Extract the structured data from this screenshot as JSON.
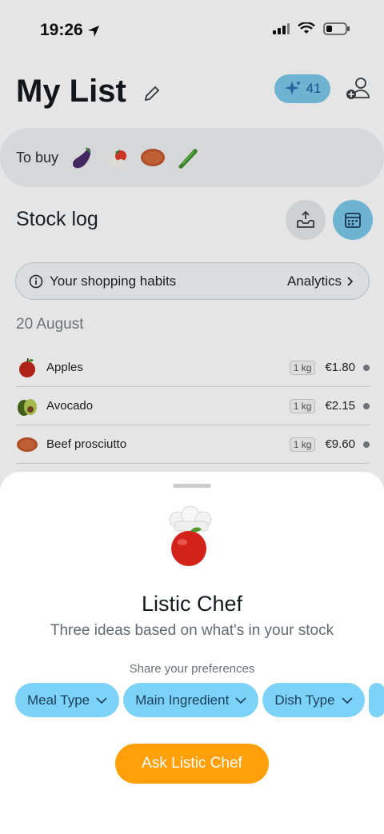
{
  "status_bar": {
    "time": "19:26"
  },
  "header": {
    "title": "My List",
    "ai_credits": "41"
  },
  "to_buy": {
    "label": "To buy",
    "items": [
      "eggplant-icon",
      "caprese-icon",
      "beef-prosciutto-icon",
      "cucumber-icon"
    ]
  },
  "stock_log": {
    "title": "Stock log",
    "habits_label": "Your shopping habits",
    "analytics_label": "Analytics",
    "date": "20 August",
    "rows": [
      {
        "name": "Apples",
        "qty": "1 kg",
        "price": "€1.80",
        "icon": "apple-icon"
      },
      {
        "name": "Avocado",
        "qty": "1 kg",
        "price": "€2.15",
        "icon": "avocado-icon"
      },
      {
        "name": "Beef prosciutto",
        "qty": "1 kg",
        "price": "€9.60",
        "icon": "beef-prosciutto-icon"
      }
    ]
  },
  "sheet": {
    "title": "Listic Chef",
    "subtitle": "Three ideas based on what's in your stock",
    "preferences_label": "Share your preferences",
    "chips": [
      "Meal Type",
      "Main Ingredient",
      "Dish Type"
    ],
    "ask_button": "Ask Listic Chef"
  },
  "colors": {
    "accent_blue": "#7dd3f7",
    "ask_orange": "#ff9f0a",
    "badge_blue": "#7cc8ea"
  }
}
